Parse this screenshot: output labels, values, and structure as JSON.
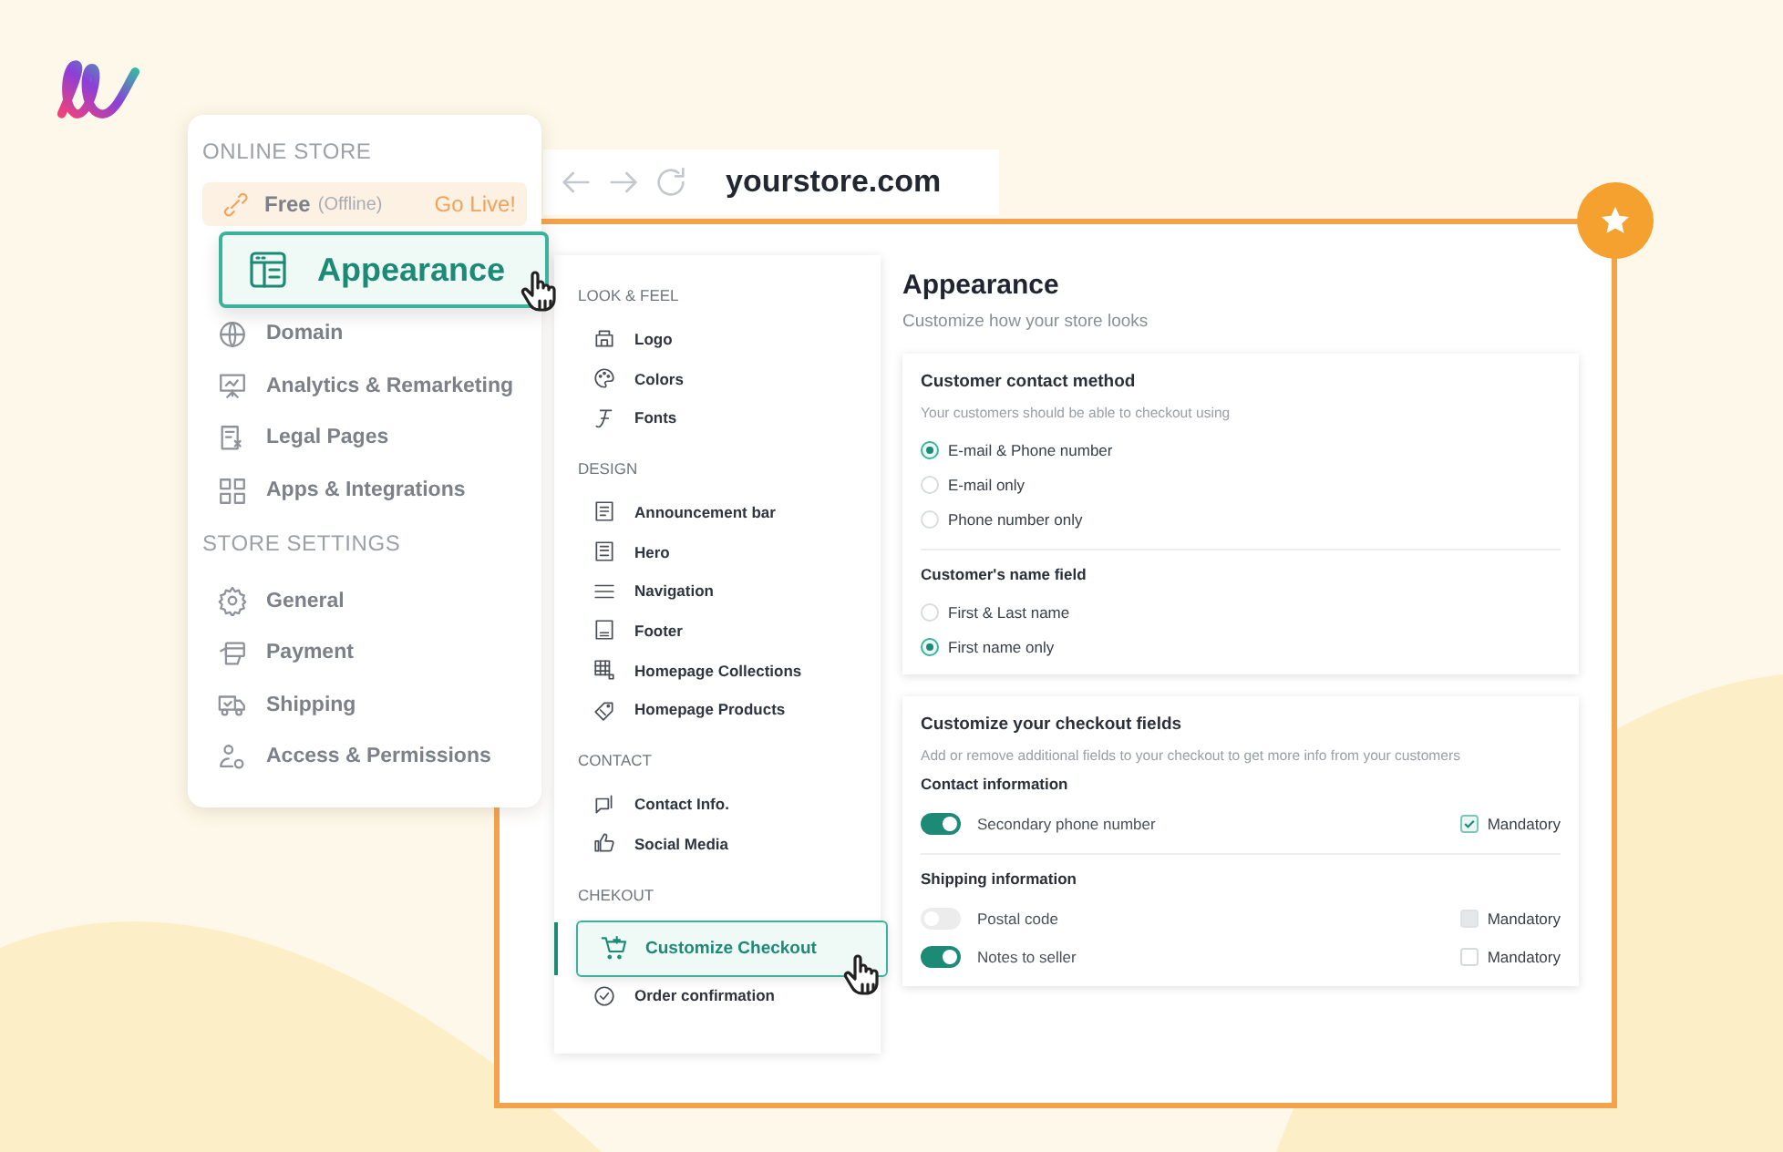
{
  "store_menu": {
    "sections": [
      {
        "title": "ONLINE STORE",
        "items": [
          {
            "kind": "plan",
            "label": "Free",
            "note": "(Offline)",
            "action": "Go Live!"
          },
          {
            "kind": "item",
            "label": "Appearance",
            "selected": true
          },
          {
            "kind": "item",
            "label": "Domain",
            "selected": false
          },
          {
            "kind": "item",
            "label": "Analytics & Remarketing",
            "selected": false
          },
          {
            "kind": "item",
            "label": "Legal Pages",
            "selected": false
          },
          {
            "kind": "item",
            "label": "Apps & Integrations",
            "selected": false
          }
        ]
      },
      {
        "title": "STORE SETTINGS",
        "items": [
          {
            "kind": "item",
            "label": "General",
            "selected": false
          },
          {
            "kind": "item",
            "label": "Payment",
            "selected": false
          },
          {
            "kind": "item",
            "label": "Shipping",
            "selected": false
          },
          {
            "kind": "item",
            "label": "Access & Permissions",
            "selected": false
          }
        ]
      }
    ]
  },
  "browser": {
    "url": "yourstore.com"
  },
  "settings_nav": {
    "sections": [
      {
        "title": "LOOK & FEEL",
        "items": [
          {
            "label": "Logo",
            "selected": false
          },
          {
            "label": "Colors",
            "selected": false
          },
          {
            "label": "Fonts",
            "selected": false
          }
        ]
      },
      {
        "title": "DESIGN",
        "items": [
          {
            "label": "Announcement bar",
            "selected": false
          },
          {
            "label": "Hero",
            "selected": false
          },
          {
            "label": "Navigation",
            "selected": false
          },
          {
            "label": "Footer",
            "selected": false
          },
          {
            "label": "Homepage Collections",
            "selected": false
          },
          {
            "label": "Homepage Products",
            "selected": false
          }
        ]
      },
      {
        "title": "CONTACT",
        "items": [
          {
            "label": "Contact Info.",
            "selected": false
          },
          {
            "label": "Social Media",
            "selected": false
          }
        ]
      },
      {
        "title": "CHEKOUT",
        "items": [
          {
            "label": "Customize Checkout",
            "selected": true
          },
          {
            "label": "Order confirmation",
            "selected": false
          }
        ]
      }
    ]
  },
  "page": {
    "title": "Appearance",
    "subtitle": "Customize how your store looks"
  },
  "cards": [
    {
      "kind": "radio",
      "title": "Customer contact method",
      "description": "Your customers should be able to checkout using",
      "groups": [
        {
          "options": [
            {
              "label": "E-mail & Phone number",
              "selected": true
            },
            {
              "label": "E-mail only",
              "selected": false
            },
            {
              "label": "Phone number only",
              "selected": false
            }
          ]
        },
        {
          "heading": "Customer's name field",
          "options": [
            {
              "label": "First & Last name",
              "selected": false
            },
            {
              "label": "First name only",
              "selected": true
            }
          ]
        }
      ]
    },
    {
      "kind": "toggle",
      "title": "Customize your checkout fields",
      "description": "Add or remove additional fields to your checkout to get more info from your customers",
      "groups": [
        {
          "heading": "Contact information",
          "fields": [
            {
              "label": "Secondary phone number",
              "on": true,
              "mandatory": true,
              "disabled": false,
              "mandatory_label": "Mandatory"
            }
          ]
        },
        {
          "heading": "Shipping information",
          "fields": [
            {
              "label": "Postal code",
              "on": false,
              "mandatory": false,
              "disabled": true,
              "mandatory_label": "Mandatory"
            },
            {
              "label": "Notes to seller",
              "on": true,
              "mandatory": false,
              "disabled": false,
              "mandatory_label": "Mandatory"
            }
          ]
        }
      ]
    }
  ]
}
